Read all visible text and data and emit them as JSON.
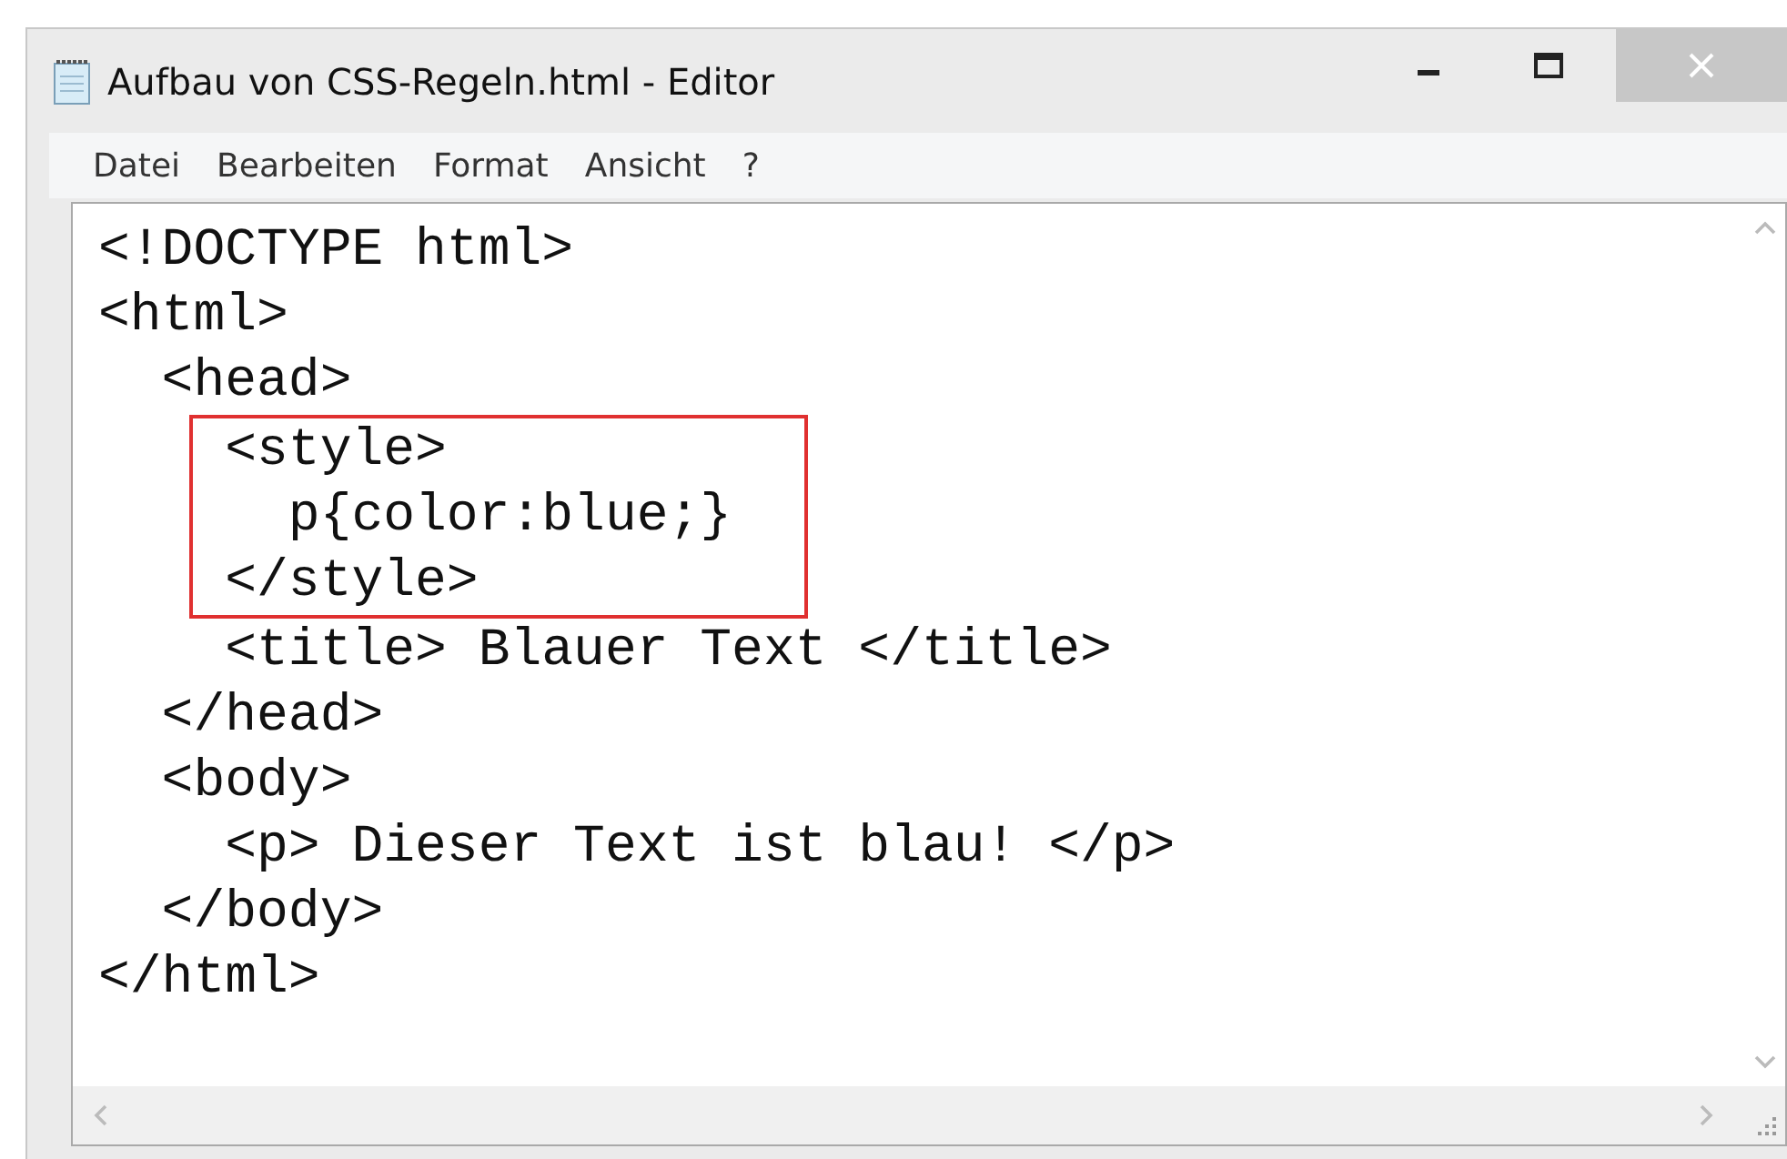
{
  "window": {
    "title": "Aufbau von CSS-Regeln.html - Editor"
  },
  "menu": [
    {
      "label": "Datei"
    },
    {
      "label": "Bearbeiten"
    },
    {
      "label": "Format"
    },
    {
      "label": "Ansicht"
    },
    {
      "label": "?"
    }
  ],
  "editor": {
    "lines": [
      {
        "text": "<!DOCTYPE html>",
        "highlighted": false
      },
      {
        "text": "<html>",
        "highlighted": false
      },
      {
        "text": "  <head>",
        "highlighted": false
      },
      {
        "text": "    <style>",
        "highlighted": true
      },
      {
        "text": "      p{color:blue;}",
        "highlighted": true
      },
      {
        "text": "    </style>",
        "highlighted": true
      },
      {
        "text": "    <title> Blauer Text </title>",
        "highlighted": false
      },
      {
        "text": "  </head>",
        "highlighted": false
      },
      {
        "text": "  <body>",
        "highlighted": false
      },
      {
        "text": "    <p> Dieser Text ist blau! </p>",
        "highlighted": false
      },
      {
        "text": "  </body>",
        "highlighted": false
      },
      {
        "text": "</html>",
        "highlighted": false
      }
    ]
  }
}
